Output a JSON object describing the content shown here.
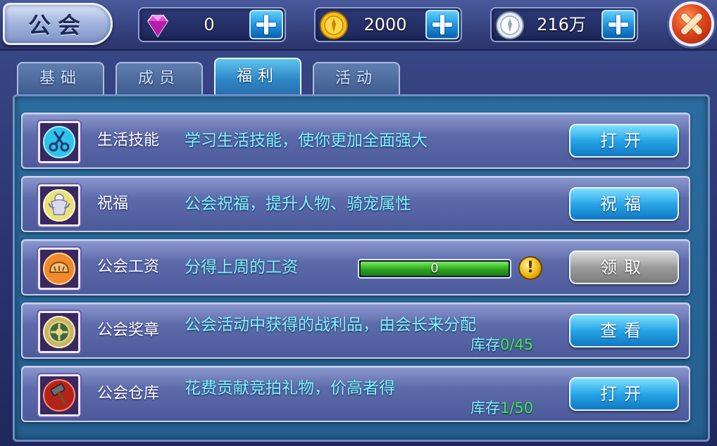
{
  "window": {
    "title": "公会"
  },
  "currencies": [
    {
      "icon": "diamond-icon",
      "value": "0"
    },
    {
      "icon": "gold-coin-icon",
      "value": "2000"
    },
    {
      "icon": "silver-coin-icon",
      "value": "216万"
    }
  ],
  "tabs": [
    {
      "label": "基础",
      "active": false
    },
    {
      "label": "成员",
      "active": false
    },
    {
      "label": "福利",
      "active": true
    },
    {
      "label": "活动",
      "active": false
    }
  ],
  "rows": [
    {
      "name": "生活技能",
      "desc": "学习生活技能，使你更加全面强大",
      "button": "打开",
      "icon": "scissors-icon"
    },
    {
      "name": "祝福",
      "desc": "公会祝福，提升人物、骑宠属性",
      "button": "祝福",
      "icon": "angel-statue-icon"
    },
    {
      "name": "公会工资",
      "desc": "分得上周的工资",
      "button": "领取",
      "icon": "bread-icon",
      "progress": {
        "text": "0",
        "fraction": 1.0
      }
    },
    {
      "name": "公会奖章",
      "desc": "公会活动中获得的战利品，由会长来分配",
      "button": "查看",
      "icon": "medal-icon",
      "stock": {
        "label": "库存",
        "value": "0/45"
      }
    },
    {
      "name": "公会仓库",
      "desc": "花费贡献竞拍礼物，价高者得",
      "button": "打开",
      "icon": "hammer-icon",
      "stock": {
        "label": "库存",
        "value": "1/50"
      }
    }
  ],
  "colors": {
    "accent": "#27a6e6",
    "desc_text": "#7ef6ff",
    "stock_number": "#3dea4e"
  }
}
